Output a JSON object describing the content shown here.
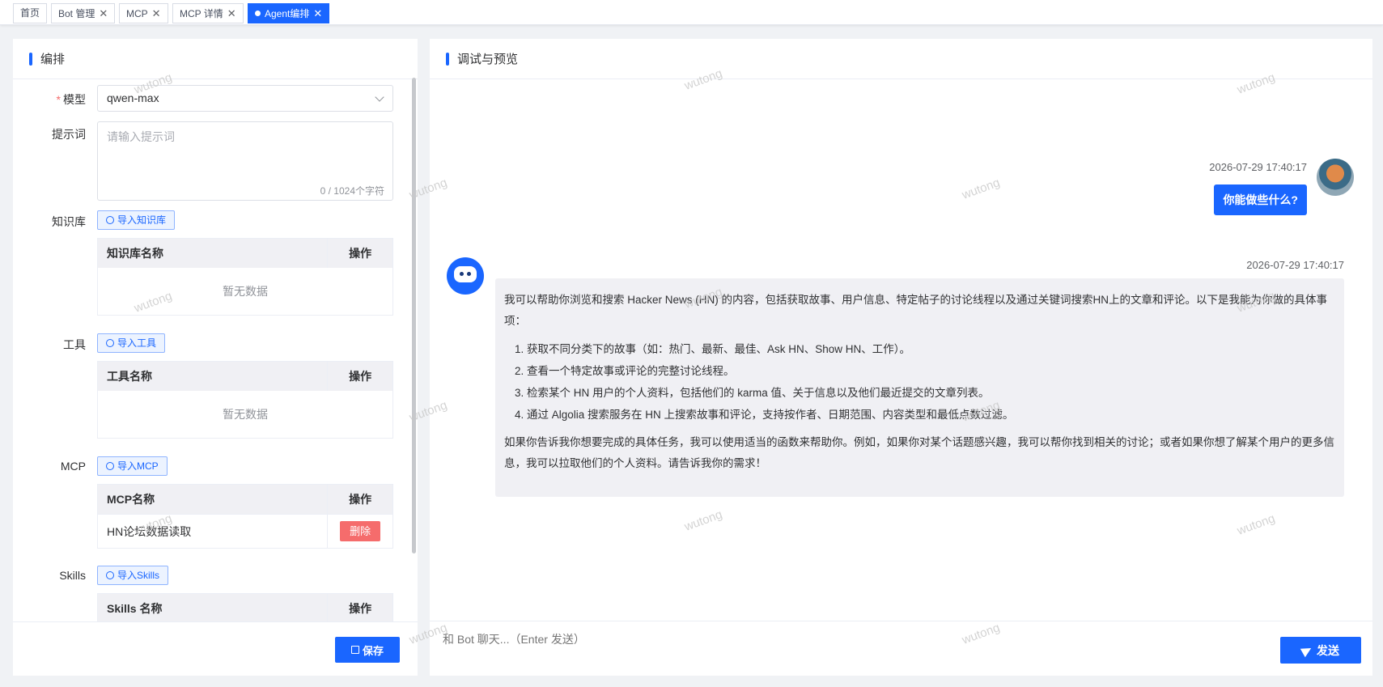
{
  "tabs": [
    {
      "label": "首页",
      "closable": false,
      "active": false
    },
    {
      "label": "Bot 管理",
      "closable": true,
      "active": false
    },
    {
      "label": "MCP",
      "closable": true,
      "active": false
    },
    {
      "label": "MCP 详情",
      "closable": true,
      "active": false
    },
    {
      "label": "Agent编排",
      "closable": true,
      "active": true
    }
  ],
  "left": {
    "title": "编排",
    "model": {
      "label": "模型",
      "required": true,
      "value": "qwen-max"
    },
    "prompt": {
      "label": "提示词",
      "placeholder": "请输入提示词",
      "count": "0 / 1024个字符"
    },
    "knowledge": {
      "label": "知识库",
      "button": "导入知识库",
      "col_name": "知识库名称",
      "col_op": "操作",
      "empty": "暂无数据"
    },
    "tools": {
      "label": "工具",
      "button": "导入工具",
      "col_name": "工具名称",
      "col_op": "操作",
      "empty": "暂无数据"
    },
    "mcp": {
      "label": "MCP",
      "button": "导入MCP",
      "col_name": "MCP名称",
      "col_op": "操作",
      "rows": [
        {
          "name": "HN论坛数据读取",
          "action": "删除"
        }
      ]
    },
    "skills": {
      "label": "Skills",
      "button": "导入Skills",
      "col_name": "Skills 名称",
      "col_op": "操作"
    },
    "save_label": "保存"
  },
  "right": {
    "title": "调试与预览",
    "messages": {
      "user": {
        "time": "2026-07-29 17:40:17",
        "text": "你能做些什么?"
      },
      "bot": {
        "time": "2026-07-29 17:40:17",
        "intro": "我可以帮助你浏览和搜索 Hacker News (HN) 的内容，包括获取故事、用户信息、特定帖子的讨论线程以及通过关键词搜索HN上的文章和评论。以下是我能为你做的具体事项：",
        "items": [
          "获取不同分类下的故事（如：热门、最新、最佳、Ask HN、Show HN、工作）。",
          "查看一个特定故事或评论的完整讨论线程。",
          "检索某个 HN 用户的个人资料，包括他们的 karma 值、关于信息以及他们最近提交的文章列表。",
          "通过 Algolia 搜索服务在 HN 上搜索故事和评论，支持按作者、日期范围、内容类型和最低点数过滤。"
        ],
        "outro": "如果你告诉我你想要完成的具体任务，我可以使用适当的函数来帮助你。例如，如果你对某个话题感兴趣，我可以帮你找到相关的讨论；或者如果你想了解某个用户的更多信息，我可以拉取他们的个人资料。请告诉我你的需求！"
      }
    },
    "input_placeholder": "和 Bot 聊天...（Enter 发送）",
    "send_label": "发送"
  },
  "watermark": "wutong",
  "colors": {
    "primary": "#1a66ff",
    "danger": "#f56c6c"
  }
}
